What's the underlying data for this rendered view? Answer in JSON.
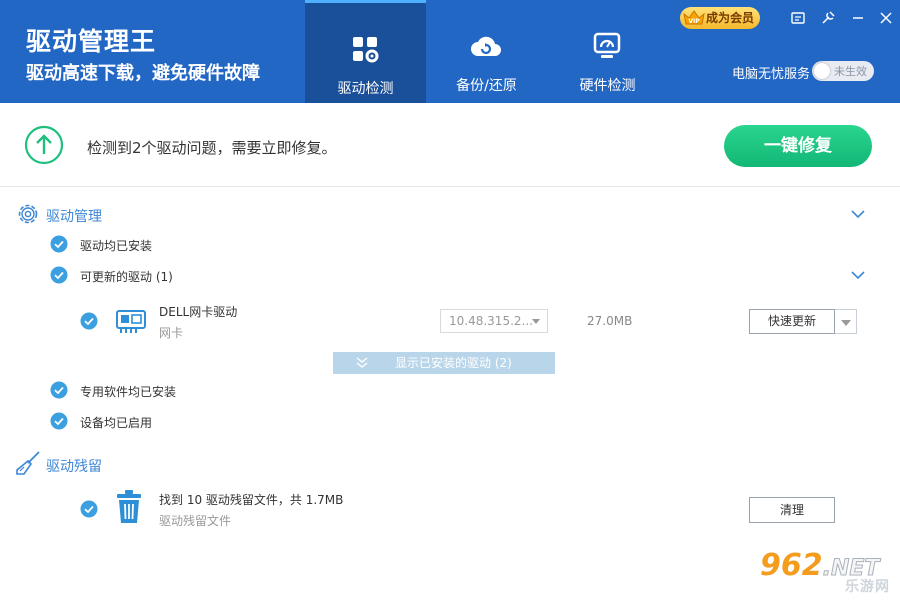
{
  "header": {
    "brand_title": "驱动管理王",
    "brand_subtitle": "驱动高速下载，避免硬件故障",
    "tabs": [
      {
        "label": "驱动检测",
        "icon": "grid-gear-icon",
        "active": true
      },
      {
        "label": "备份/还原",
        "icon": "cloud-sync-icon",
        "active": false
      },
      {
        "label": "硬件检测",
        "icon": "monitor-gauge-icon",
        "active": false
      }
    ],
    "vip_label": "成为会员",
    "vip_badge_text": "VIP",
    "service_label": "电脑无忧服务",
    "service_toggle_text": "未生效",
    "window_controls": [
      "message-icon",
      "skin-icon",
      "minimize-icon",
      "close-icon"
    ]
  },
  "status": {
    "message": "检测到2个驱动问题，需要立即修复。",
    "fix_button": "一键修复",
    "icon": "arrow-up-circle-icon"
  },
  "sections": {
    "driver_manage": {
      "title": "驱动管理",
      "icon": "gear-icon",
      "items": {
        "all_installed": "驱动均已安装",
        "updatable": "可更新的驱动 (1)",
        "special_software": "专用软件均已安装",
        "devices_enabled": "设备均已启用"
      },
      "driver": {
        "name": "DELL网卡驱动",
        "type": "网卡",
        "version": "10.48.315.2...",
        "size": "27.0MB",
        "update_button": "快速更新",
        "icon": "network-card-icon"
      },
      "show_installed": "显示已安装的驱动 (2)"
    },
    "residue": {
      "title": "驱动残留",
      "icon": "broom-icon",
      "item_title": "找到 10 驱动残留文件，共 1.7MB",
      "item_sub": "驱动残留文件",
      "clean_button": "清理",
      "icon_item": "trash-icon"
    }
  },
  "watermark": {
    "logo_digits": "962",
    "logo_net": ".NET",
    "logo_sub": "乐游网"
  },
  "colors": {
    "header_bg": "#2267c4",
    "active_tab_bg": "#1a4f99",
    "accent_blue": "#3d87d6",
    "fix_green": "#12b775",
    "check_blue": "#3b9fe0"
  }
}
